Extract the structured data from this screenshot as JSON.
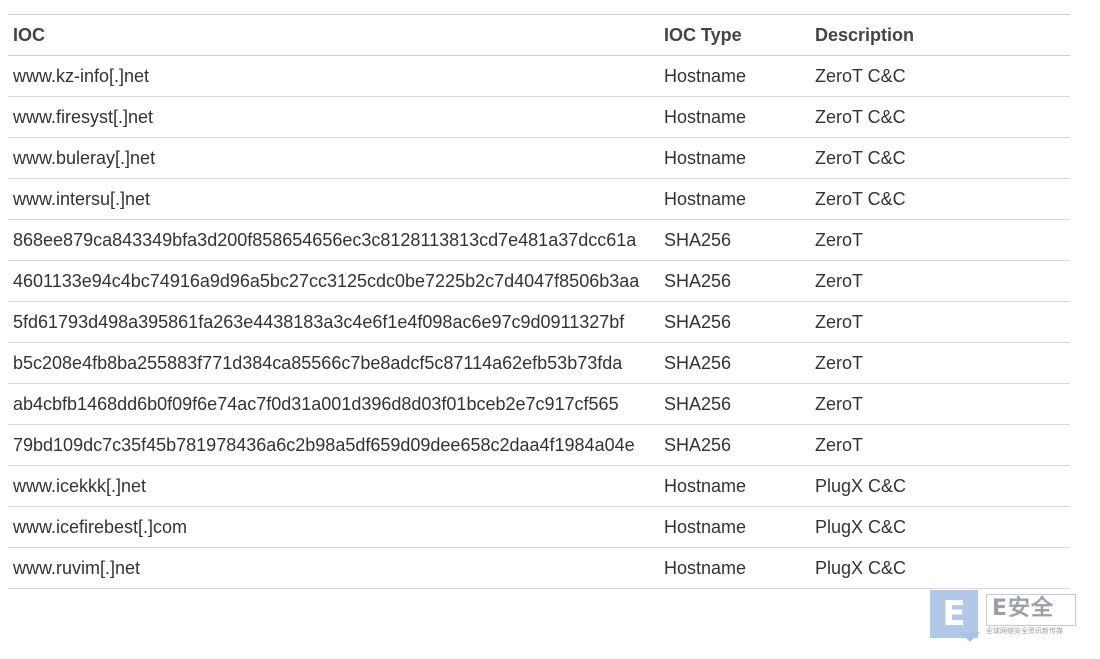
{
  "table": {
    "headers": [
      "IOC",
      "IOC Type",
      "Description"
    ],
    "rows": [
      {
        "ioc": "www.kz-info[.]net",
        "type": "Hostname",
        "description": "ZeroT C&C"
      },
      {
        "ioc": "www.firesyst[.]net",
        "type": "Hostname",
        "description": "ZeroT C&C"
      },
      {
        "ioc": "www.buleray[.]net",
        "type": "Hostname",
        "description": "ZeroT C&C"
      },
      {
        "ioc": "www.intersu[.]net",
        "type": "Hostname",
        "description": "ZeroT C&C"
      },
      {
        "ioc": "868ee879ca843349bfa3d200f858654656ec3c8128113813cd7e481a37dcc61a",
        "type": "SHA256",
        "description": "ZeroT"
      },
      {
        "ioc": "4601133e94c4bc74916a9d96a5bc27cc3125cdc0be7225b2c7d4047f8506b3aa",
        "type": "SHA256",
        "description": "ZeroT"
      },
      {
        "ioc": "5fd61793d498a395861fa263e4438183a3c4e6f1e4f098ac6e97c9d0911327bf",
        "type": "SHA256",
        "description": "ZeroT"
      },
      {
        "ioc": "b5c208e4fb8ba255883f771d384ca85566c7be8adcf5c87114a62efb53b73fda",
        "type": "SHA256",
        "description": "ZeroT"
      },
      {
        "ioc": "ab4cbfb1468dd6b0f09f6e74ac7f0d31a001d396d8d03f01bceb2e7c917cf565",
        "type": "SHA256",
        "description": "ZeroT"
      },
      {
        "ioc": "79bd109dc7c35f45b781978436a6c2b98a5df659d09dee658c2daa4f1984a04e",
        "type": "SHA256",
        "description": "ZeroT"
      },
      {
        "ioc": "www.icekkk[.]net",
        "type": "Hostname",
        "description": "PlugX C&C"
      },
      {
        "ioc": "www.icefirebest[.]com",
        "type": "Hostname",
        "description": "PlugX C&C"
      },
      {
        "ioc": "www.ruvim[.]net",
        "type": "Hostname",
        "description": "PlugX C&C"
      }
    ]
  },
  "watermark": {
    "letter": "E",
    "title": "E安全",
    "subtitle": "全球网络安全资讯新传媒",
    "accent_color": "#a9c3e6"
  }
}
